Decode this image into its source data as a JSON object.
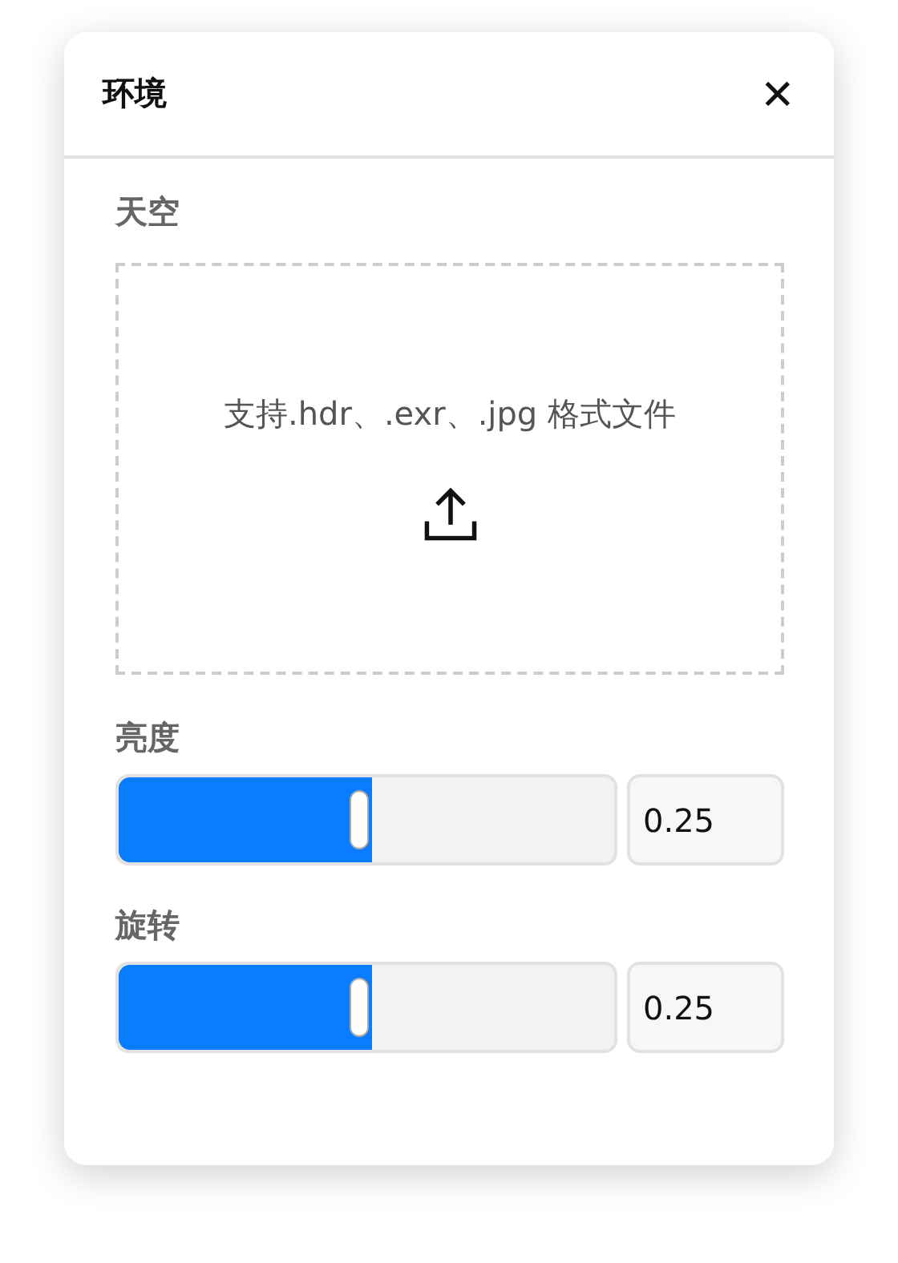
{
  "panel": {
    "title": "环境",
    "close": "✕"
  },
  "sky": {
    "label": "天空",
    "dropzone_text": "支持.hdr、.exr、.jpg 格式文件"
  },
  "sliders": [
    {
      "label": "亮度",
      "level": 0.51,
      "value": "0.25"
    },
    {
      "label": "旋转",
      "level": 0.51,
      "value": "0.25"
    }
  ]
}
